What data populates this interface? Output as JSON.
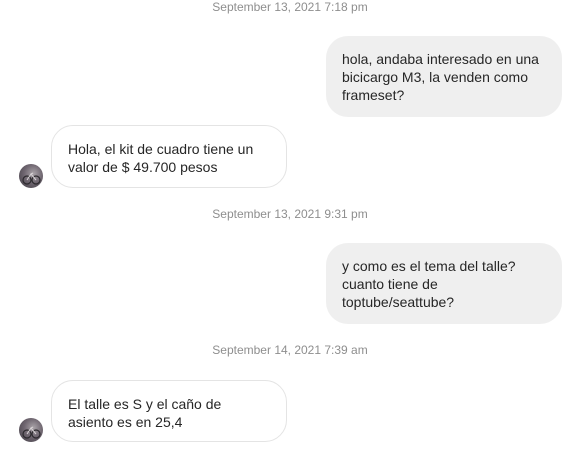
{
  "conversation": {
    "timestamps": [
      "September 13, 2021 7:18 pm",
      "September 13, 2021 9:31 pm",
      "September 14, 2021 7:39 am"
    ],
    "messages": [
      {
        "sender": "me",
        "text": "hola, andaba interesado en una bicicargo M3, la venden como frameset?"
      },
      {
        "sender": "them",
        "text": "Hola, el kit de cuadro tiene un valor de $ 49.700 pesos"
      },
      {
        "sender": "me",
        "text": "y como es el tema del talle? cuanto tiene de toptube/seattube?"
      },
      {
        "sender": "them",
        "text": "El talle es S y el caño de asiento es en 25,4"
      }
    ],
    "avatar_icon": "user-avatar-photo"
  }
}
